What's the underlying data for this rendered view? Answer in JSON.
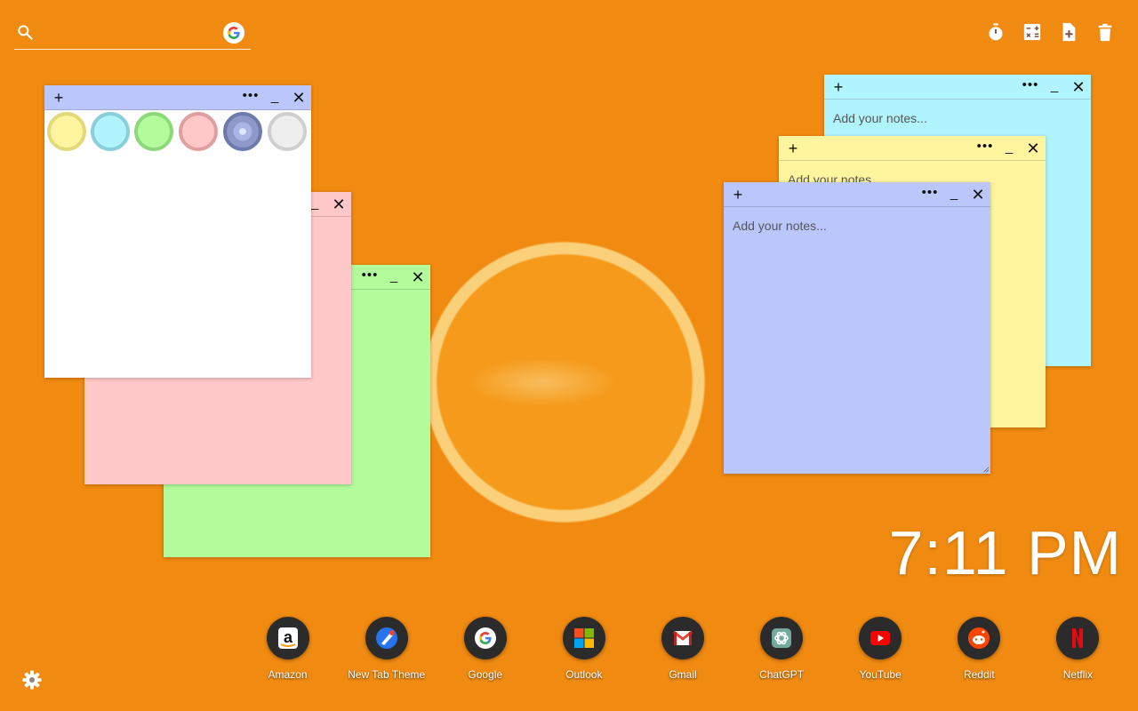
{
  "search": {
    "placeholder": "",
    "value": "",
    "engine_icon": "google-icon"
  },
  "tools": [
    {
      "name": "timer",
      "icon": "stopwatch-icon"
    },
    {
      "name": "calculator",
      "icon": "calculator-icon"
    },
    {
      "name": "new-note",
      "icon": "add-note-icon"
    },
    {
      "name": "delete",
      "icon": "trash-icon"
    }
  ],
  "notes": {
    "placeholder": "Add your notes...",
    "plus": "+",
    "more": "•••",
    "min": "_",
    "close": "✕",
    "colors": {
      "white": "#ffffff",
      "pink": "#ffc8c8",
      "green": "#b2fc9c",
      "cyan": "#b0f4fd",
      "yellow": "#fef59e",
      "purple": "#bbc6fb"
    }
  },
  "palette": [
    {
      "name": "yellow",
      "fill": "#fef59e",
      "ring": "#e2d97a"
    },
    {
      "name": "cyan",
      "fill": "#b0f4fd",
      "ring": "#86cfdb"
    },
    {
      "name": "green",
      "fill": "#b2fc9c",
      "ring": "#8cd87a"
    },
    {
      "name": "pink",
      "fill": "#ffc8c8",
      "ring": "#e09ea0"
    },
    {
      "name": "purple",
      "fill": "#8e99c9",
      "ring": "#6f7aac"
    },
    {
      "name": "gray",
      "fill": "#eeeeee",
      "ring": "#cfcfcf"
    }
  ],
  "clock": {
    "time": "7:11 PM"
  },
  "shortcuts": [
    {
      "label": "Amazon",
      "icon": "amazon-icon"
    },
    {
      "label": "New Tab Theme",
      "icon": "new-tab-theme-icon"
    },
    {
      "label": "Google",
      "icon": "google-icon"
    },
    {
      "label": "Outlook",
      "icon": "outlook-icon"
    },
    {
      "label": "Gmail",
      "icon": "gmail-icon"
    },
    {
      "label": "ChatGPT",
      "icon": "chatgpt-icon"
    },
    {
      "label": "YouTube",
      "icon": "youtube-icon"
    },
    {
      "label": "Reddit",
      "icon": "reddit-icon"
    },
    {
      "label": "Netflix",
      "icon": "netflix-icon"
    }
  ],
  "settings": {
    "icon": "gear-icon"
  }
}
